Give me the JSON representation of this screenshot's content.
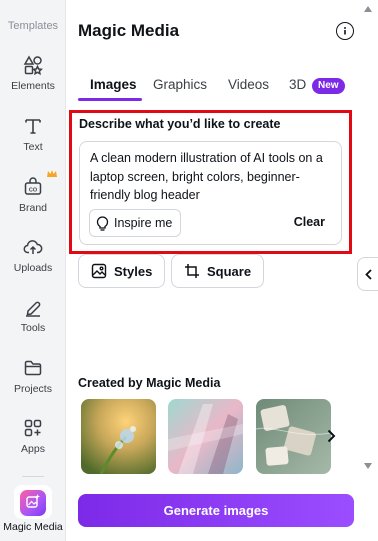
{
  "rail": {
    "top_label": "Templates",
    "items": [
      {
        "label": "Elements",
        "icon": "elements-icon"
      },
      {
        "label": "Text",
        "icon": "text-icon"
      },
      {
        "label": "Brand",
        "icon": "brand-icon"
      },
      {
        "label": "Uploads",
        "icon": "uploads-icon"
      },
      {
        "label": "Tools",
        "icon": "tools-icon"
      },
      {
        "label": "Projects",
        "icon": "projects-icon"
      },
      {
        "label": "Apps",
        "icon": "apps-icon"
      },
      {
        "label": "Magic Media",
        "icon": "magic-media-icon"
      }
    ]
  },
  "panel": {
    "title": "Magic Media",
    "tabs": [
      "Images",
      "Graphics",
      "Videos",
      "3D"
    ],
    "new_badge": "New",
    "prompt_label": "Describe what you’d like to create",
    "prompt_text": "A clean modern illustration of AI tools on a laptop screen, bright colors, beginner-friendly blog header",
    "inspire_label": "Inspire me",
    "clear_label": "Clear",
    "styles_label": "Styles",
    "aspect_label": "Square",
    "section_title": "Created by Magic Media",
    "generate_label": "Generate images"
  },
  "colors": {
    "accent": "#7d2ae8",
    "highlight_border": "#e00914",
    "crown": "#f5a623"
  }
}
